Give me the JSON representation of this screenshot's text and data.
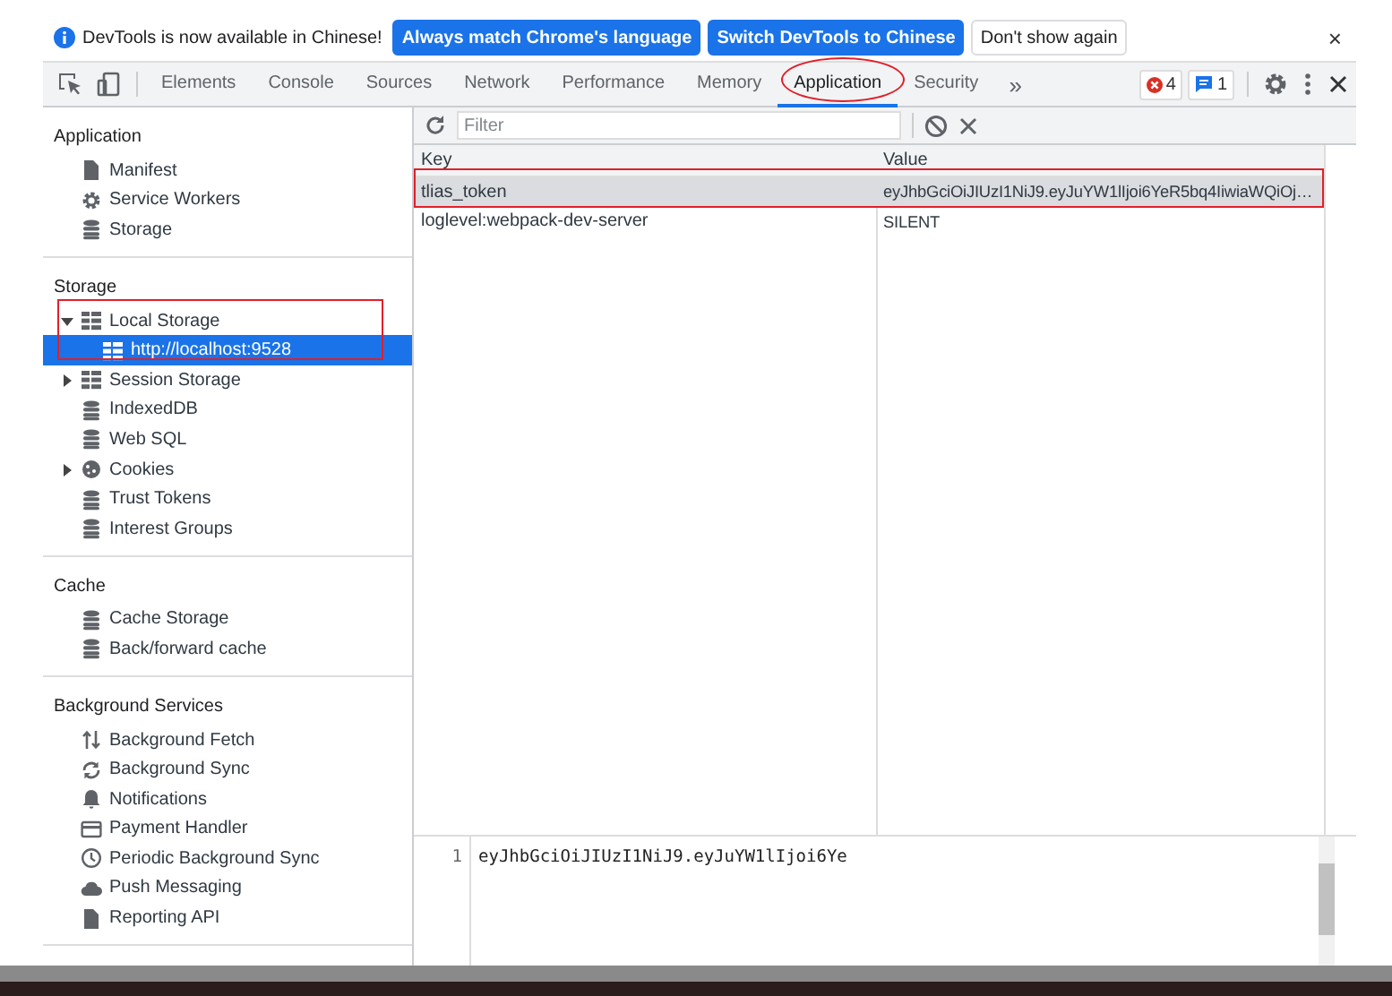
{
  "infobar": {
    "message": "DevTools is now available in Chinese!",
    "buttons": [
      {
        "label": "Always match Chrome's language",
        "kind": "primary"
      },
      {
        "label": "Switch DevTools to Chinese",
        "kind": "primary"
      },
      {
        "label": "Don't show again",
        "kind": "secondary"
      }
    ],
    "close": "×"
  },
  "tabs": [
    {
      "label": "Elements",
      "selected": false
    },
    {
      "label": "Console",
      "selected": false
    },
    {
      "label": "Sources",
      "selected": false
    },
    {
      "label": "Network",
      "selected": false
    },
    {
      "label": "Performance",
      "selected": false
    },
    {
      "label": "Memory",
      "selected": false
    },
    {
      "label": "Application",
      "selected": true
    },
    {
      "label": "Security",
      "selected": false
    }
  ],
  "more_tabs": "»",
  "error_count": "4",
  "message_count": "1",
  "sidebar": {
    "sections": [
      {
        "title": "Application",
        "items": [
          {
            "label": "Manifest",
            "selected": false
          },
          {
            "label": "Service Workers",
            "selected": false
          },
          {
            "label": "Storage",
            "selected": false
          }
        ]
      },
      {
        "title": "Storage",
        "items": [
          {
            "label": "Local Storage",
            "selected": false,
            "expanded": true,
            "children": [
              {
                "label": "http://localhost:9528",
                "selected": true
              }
            ]
          },
          {
            "label": "Session Storage",
            "selected": false,
            "expanded": false
          },
          {
            "label": "IndexedDB",
            "selected": false
          },
          {
            "label": "Web SQL",
            "selected": false
          },
          {
            "label": "Cookies",
            "selected": false,
            "expanded": false
          },
          {
            "label": "Trust Tokens",
            "selected": false
          },
          {
            "label": "Interest Groups",
            "selected": false
          }
        ]
      },
      {
        "title": "Cache",
        "items": [
          {
            "label": "Cache Storage",
            "selected": false
          },
          {
            "label": "Back/forward cache",
            "selected": false
          }
        ]
      },
      {
        "title": "Background Services",
        "items": [
          {
            "label": "Background Fetch",
            "selected": false
          },
          {
            "label": "Background Sync",
            "selected": false
          },
          {
            "label": "Notifications",
            "selected": false
          },
          {
            "label": "Payment Handler",
            "selected": false
          },
          {
            "label": "Periodic Background Sync",
            "selected": false
          },
          {
            "label": "Push Messaging",
            "selected": false
          },
          {
            "label": "Reporting API",
            "selected": false
          }
        ]
      }
    ]
  },
  "storage": {
    "filter": {
      "placeholder": "Filter"
    },
    "columns": [
      "Key",
      "Value"
    ],
    "rows": [
      {
        "key": "tlias_token",
        "value": "eyJhbGciOiJIUzI1NiJ9.eyJuYW1lIjoi6YeR5bq4IiwiaWQiOj…",
        "selected": true
      },
      {
        "key": "loglevel:webpack-dev-server",
        "value": "SILENT",
        "selected": false
      }
    ],
    "preview": {
      "line_number": "1",
      "text": "eyJhbGciOiJIUzI1NiJ9.eyJuYW1lIjoi6Ye"
    }
  }
}
